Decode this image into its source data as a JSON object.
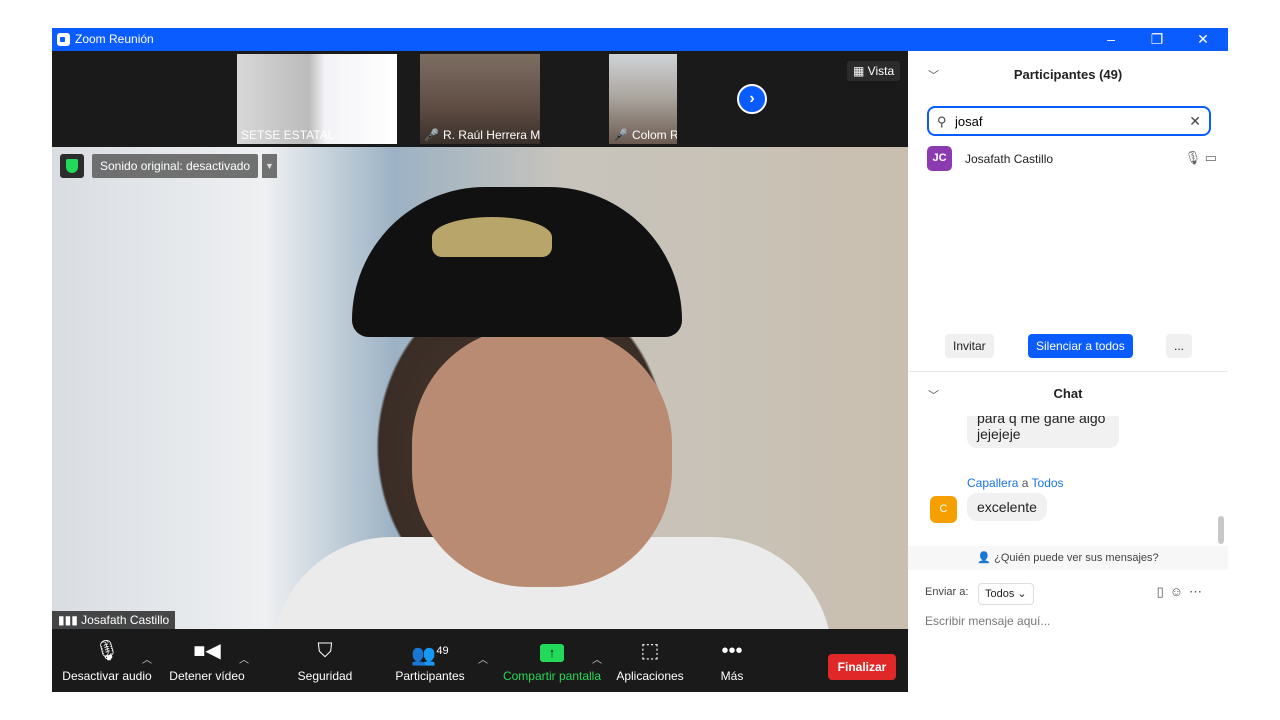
{
  "window": {
    "title": "Zoom Reunión",
    "buttons": [
      "–",
      "❐",
      "✕"
    ]
  },
  "filmstrip": {
    "thumbnails": [
      {
        "label": "SETSE ESTATAL",
        "muted": false
      },
      {
        "label": "R. Raúl Herrera Morg...",
        "muted": true
      },
      {
        "label": "Colom Rosado",
        "muted": true
      }
    ],
    "view_label": "Vista",
    "next_arrow": "›"
  },
  "main_video": {
    "audio_badge": "Sonido original: desactivado",
    "speaker_name": "Josafath Castillo"
  },
  "toolbar": {
    "audio": "Desactivar audio",
    "video": "Detener vídeo",
    "security": "Seguridad",
    "participants": "Participantes",
    "participants_count": "49",
    "share": "Compartir pantalla",
    "apps": "Aplicaciones",
    "more": "Más",
    "end": "Finalizar"
  },
  "participants_panel": {
    "title": "Participantes (49)",
    "search_value": "josaf",
    "results": [
      {
        "initials": "JC",
        "name": "Josafath Castillo"
      }
    ],
    "invite": "Invitar",
    "mute_all": "Silenciar a todos",
    "more": "..."
  },
  "chat": {
    "title": "Chat",
    "prev_message": "para q me gane algo jejejeje",
    "sender": "Capallera",
    "to_word": "a",
    "recipient": "Todos",
    "sender_initial": "C",
    "message": "excelente",
    "privacy_note": "¿Quién puede ver sus mensajes?",
    "send_to_label": "Enviar a:",
    "send_to_value": "Todos",
    "input_placeholder": "Escribir mensaje aquí..."
  },
  "colors": {
    "accent": "#0b5cff",
    "end": "#e02828",
    "share": "#23d959"
  }
}
